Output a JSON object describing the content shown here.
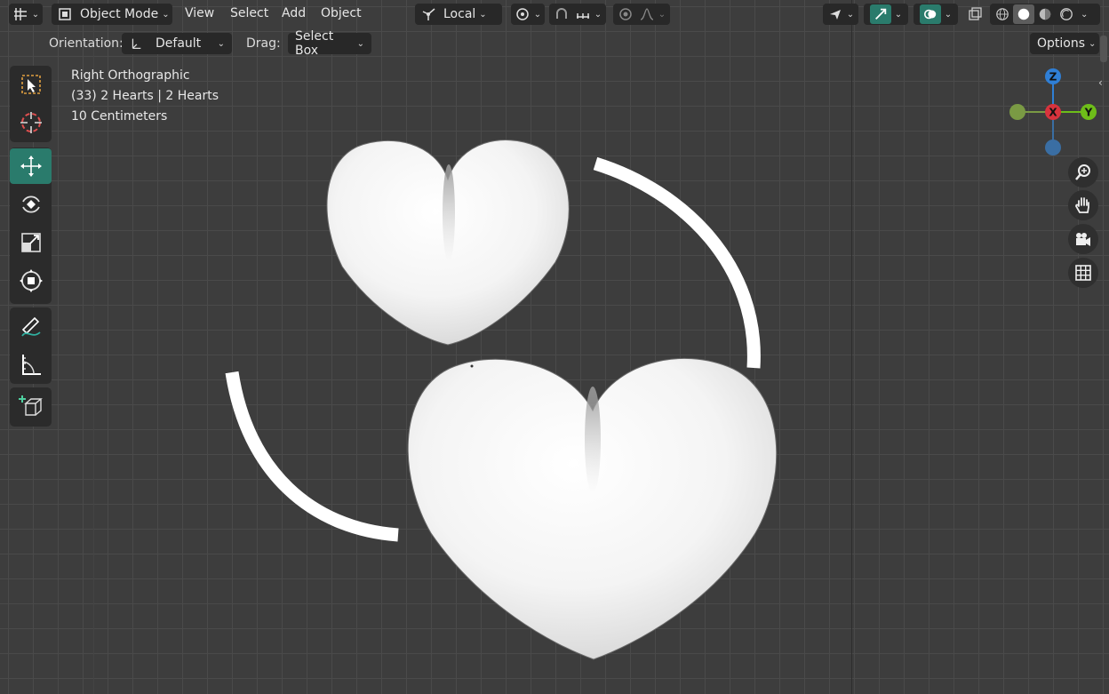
{
  "header": {
    "mode_label": "Object Mode",
    "menu": [
      "View",
      "Select",
      "Add",
      "Object"
    ],
    "transform_space": "Local"
  },
  "tool_header": {
    "orientation_label": "Orientation:",
    "orientation_value": "Default",
    "drag_label": "Drag:",
    "drag_value": "Select Box",
    "options_label": "Options"
  },
  "overlay": {
    "view_name": "Right Orthographic",
    "collection_info": "(33) 2 Hearts | 2 Hearts",
    "scale_info": "10 Centimeters"
  },
  "gizmo": {
    "z_label": "Z",
    "x_label": "X",
    "y_label": "Y",
    "colors": {
      "z": "#2f7fd6",
      "x": "#d8333d",
      "y": "#6ebe19",
      "neg_y": "#7a9a44",
      "neg_z": "#3a6ea3"
    }
  },
  "toolbar": {
    "tools": [
      "select-box",
      "cursor",
      "move",
      "rotate",
      "scale",
      "transform",
      "annotate",
      "measure",
      "add-cube"
    ],
    "active_tool": "move"
  },
  "colors": {
    "accent": "#2a7b6c",
    "background": "#3d3d3d",
    "grid": "#4a4a4a"
  }
}
